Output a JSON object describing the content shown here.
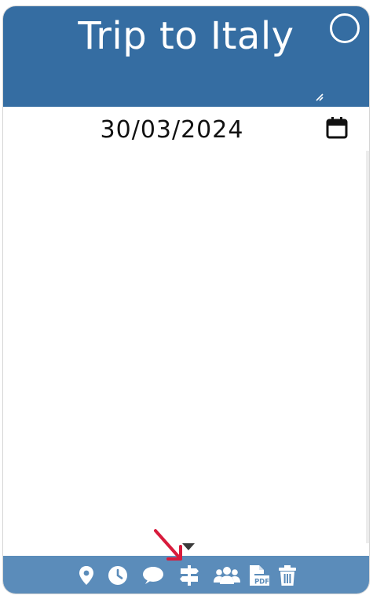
{
  "card": {
    "title": "Trip to Italy",
    "date": "30/03/2024"
  },
  "colors": {
    "header": "#356da2",
    "toolbar": "#5b8cba",
    "annotation_arrow": "#d81b3c"
  },
  "icons": {
    "header": [
      "circle-toggle-icon",
      "resize-handle-icon"
    ],
    "date": "calendar-icon",
    "dropdown": "triangle-down-icon",
    "toolbar": [
      "location-pin-icon",
      "clock-icon",
      "comment-icon",
      "signpost-icon",
      "users-icon",
      "pdf-file-icon",
      "trash-icon"
    ]
  }
}
